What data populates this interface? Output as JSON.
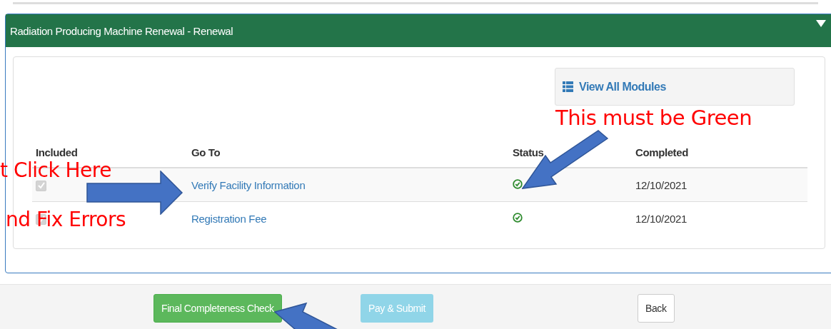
{
  "panel": {
    "title": "Radiation Producing Machine Renewal - Renewal",
    "expanded": true
  },
  "view_all_button": {
    "label": "View All Modules"
  },
  "table": {
    "columns": [
      "Included",
      "Go To",
      "Status",
      "Completed"
    ],
    "rows": [
      {
        "included": true,
        "disabled": true,
        "go_to": "Verify Facility Information",
        "complete": true,
        "completed": "12/10/2021"
      },
      {
        "included": true,
        "disabled": true,
        "go_to": "Registration Fee",
        "complete": true,
        "completed": "12/10/2021"
      }
    ]
  },
  "buttons": [
    {
      "label": "Final Completeness Check",
      "kind": "success",
      "disabled": false
    },
    {
      "label": "Pay & Submit",
      "kind": "info",
      "disabled": true
    },
    {
      "label": "Back",
      "kind": "default",
      "disabled": false
    }
  ],
  "annotations": [
    {
      "text": "This must be Green",
      "kind": "top-right"
    },
    {
      "text": "t Click Here",
      "kind": "left-top"
    },
    {
      "text": "nd Fix Errors",
      "kind": "left-bottom"
    }
  ]
}
